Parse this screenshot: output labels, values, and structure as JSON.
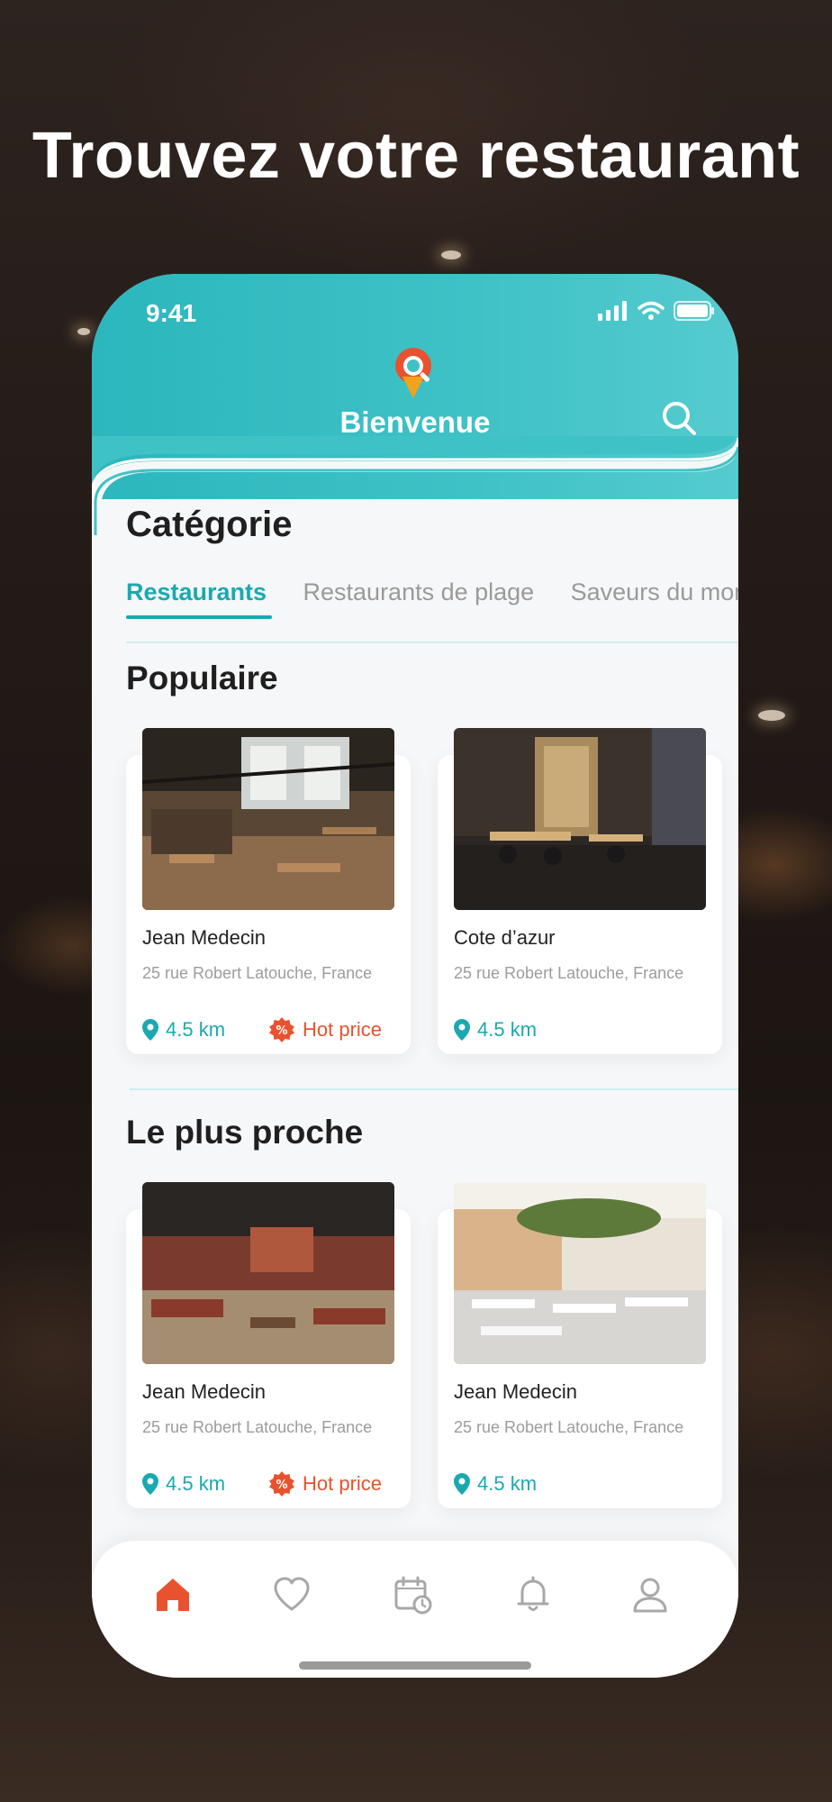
{
  "headline": "Trouvez votre restaurant",
  "status": {
    "time": "9:41"
  },
  "header": {
    "title": "Bienvenue"
  },
  "category": {
    "title": "Catégorie",
    "tabs": [
      {
        "label": "Restaurants",
        "active": true
      },
      {
        "label": "Restaurants de plage",
        "active": false
      },
      {
        "label": "Saveurs du mon",
        "active": false
      }
    ]
  },
  "popular": {
    "title": "Populaire",
    "cards": [
      {
        "name": "Jean Medecin",
        "address": "25 rue Robert Latouche, France",
        "distance": "4.5 km",
        "badge": "Hot price"
      },
      {
        "name": "Cote d’azur",
        "address": "25 rue Robert Latouche, France",
        "distance": "4.5 km"
      }
    ]
  },
  "nearest": {
    "title": "Le plus proche",
    "cards": [
      {
        "name": "Jean Medecin",
        "address": "25 rue Robert Latouche, France",
        "distance": "4.5 km",
        "badge": "Hot price"
      },
      {
        "name": "Jean Medecin",
        "address": "25 rue Robert Latouche, France",
        "distance": "4.5 km"
      }
    ]
  },
  "nav": {
    "items": [
      "home-icon",
      "heart-icon",
      "calendar-icon",
      "bell-icon",
      "profile-icon"
    ],
    "active": "home-icon"
  },
  "colors": {
    "accent": "#1aa9b0",
    "hot": "#e8522e",
    "header": "#3fc2c6"
  }
}
